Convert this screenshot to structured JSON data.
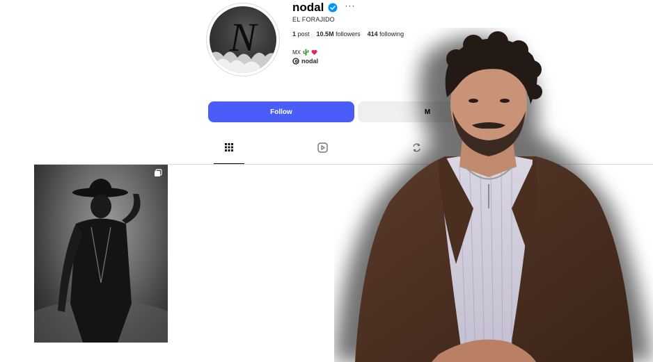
{
  "profile": {
    "username": "nodal",
    "verified": true,
    "more_label": "···",
    "full_name": "EL FORAJIDO",
    "avatar_letter": "N",
    "stats": {
      "posts_count": "1",
      "posts_label": "post",
      "followers_count": "10.5M",
      "followers_label": "followers",
      "following_count": "414",
      "following_label": "following"
    },
    "bio": "MX",
    "threads_handle": "nodal"
  },
  "actions": {
    "follow_label": "Follow",
    "message_label": "M"
  },
  "tabs": [
    {
      "name": "posts",
      "icon": "grid-icon",
      "active": true
    },
    {
      "name": "reels",
      "icon": "reels-icon",
      "active": false
    },
    {
      "name": "tagged",
      "icon": "repost-icon",
      "active": false
    }
  ],
  "colors": {
    "follow_bg": "#4a5df8",
    "verified": "#0095f6",
    "active_tab": "#000000",
    "muted_button": "#efefef"
  }
}
